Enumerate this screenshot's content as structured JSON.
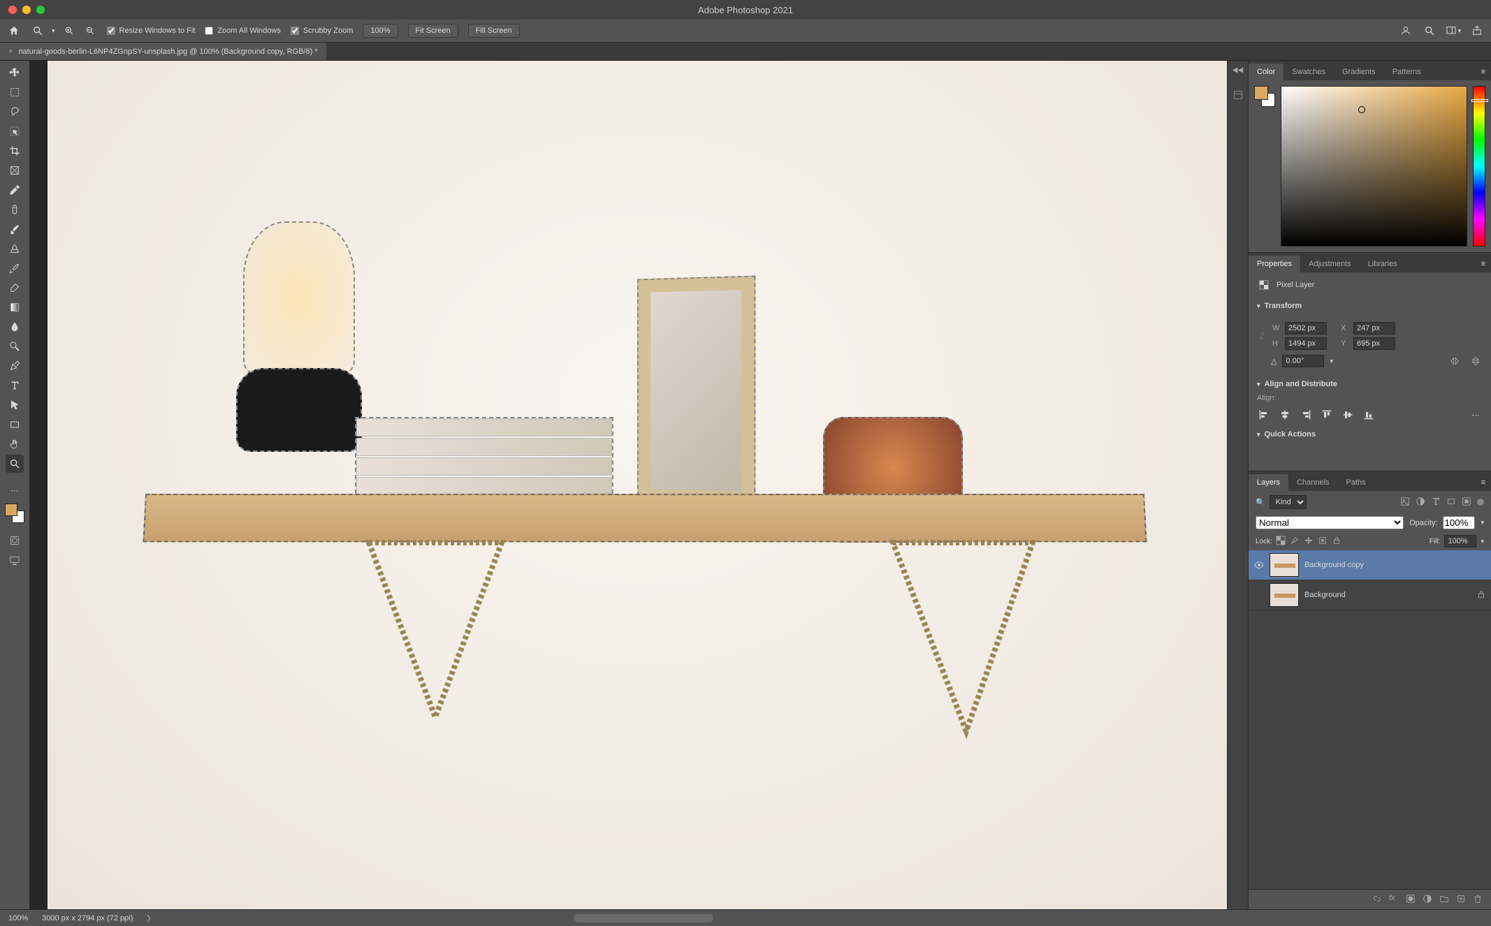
{
  "app": {
    "title": "Adobe Photoshop 2021"
  },
  "options": {
    "resize_windows": "Resize Windows to Fit",
    "zoom_all": "Zoom All Windows",
    "scrubby": "Scrubby Zoom",
    "zoom_pct": "100%",
    "fit_screen": "Fit Screen",
    "fill_screen": "Fill Screen"
  },
  "document": {
    "tab_label": "natural-goods-berlin-L6NP4ZGnpSY-unsplash.jpg @ 100% (Background copy, RGB/8) *"
  },
  "panels": {
    "color_tabs": [
      "Color",
      "Swatches",
      "Gradients",
      "Patterns"
    ],
    "prop_tabs": [
      "Properties",
      "Adjustments",
      "Libraries"
    ],
    "pixel_layer": "Pixel Layer",
    "transform": {
      "heading": "Transform",
      "w": "2502 px",
      "x": "247 px",
      "h": "1494 px",
      "y": "695 px",
      "angle": "0.00°"
    },
    "align": {
      "heading": "Align and Distribute",
      "label": "Align:"
    },
    "quick_actions": "Quick Actions",
    "layers_tabs": [
      "Layers",
      "Channels",
      "Paths"
    ],
    "kind": "Kind",
    "blend_mode": "Normal",
    "opacity_label": "Opacity:",
    "opacity": "100%",
    "lock_label": "Lock:",
    "fill_label": "Fill:",
    "fill": "100%",
    "layers": [
      {
        "name": "Background copy"
      },
      {
        "name": "Background"
      }
    ]
  },
  "status": {
    "zoom": "100%",
    "doc_info": "3000 px x 2794 px (72 ppi)"
  },
  "colors": {
    "foreground": "#d8a862",
    "background": "#ffffff"
  }
}
